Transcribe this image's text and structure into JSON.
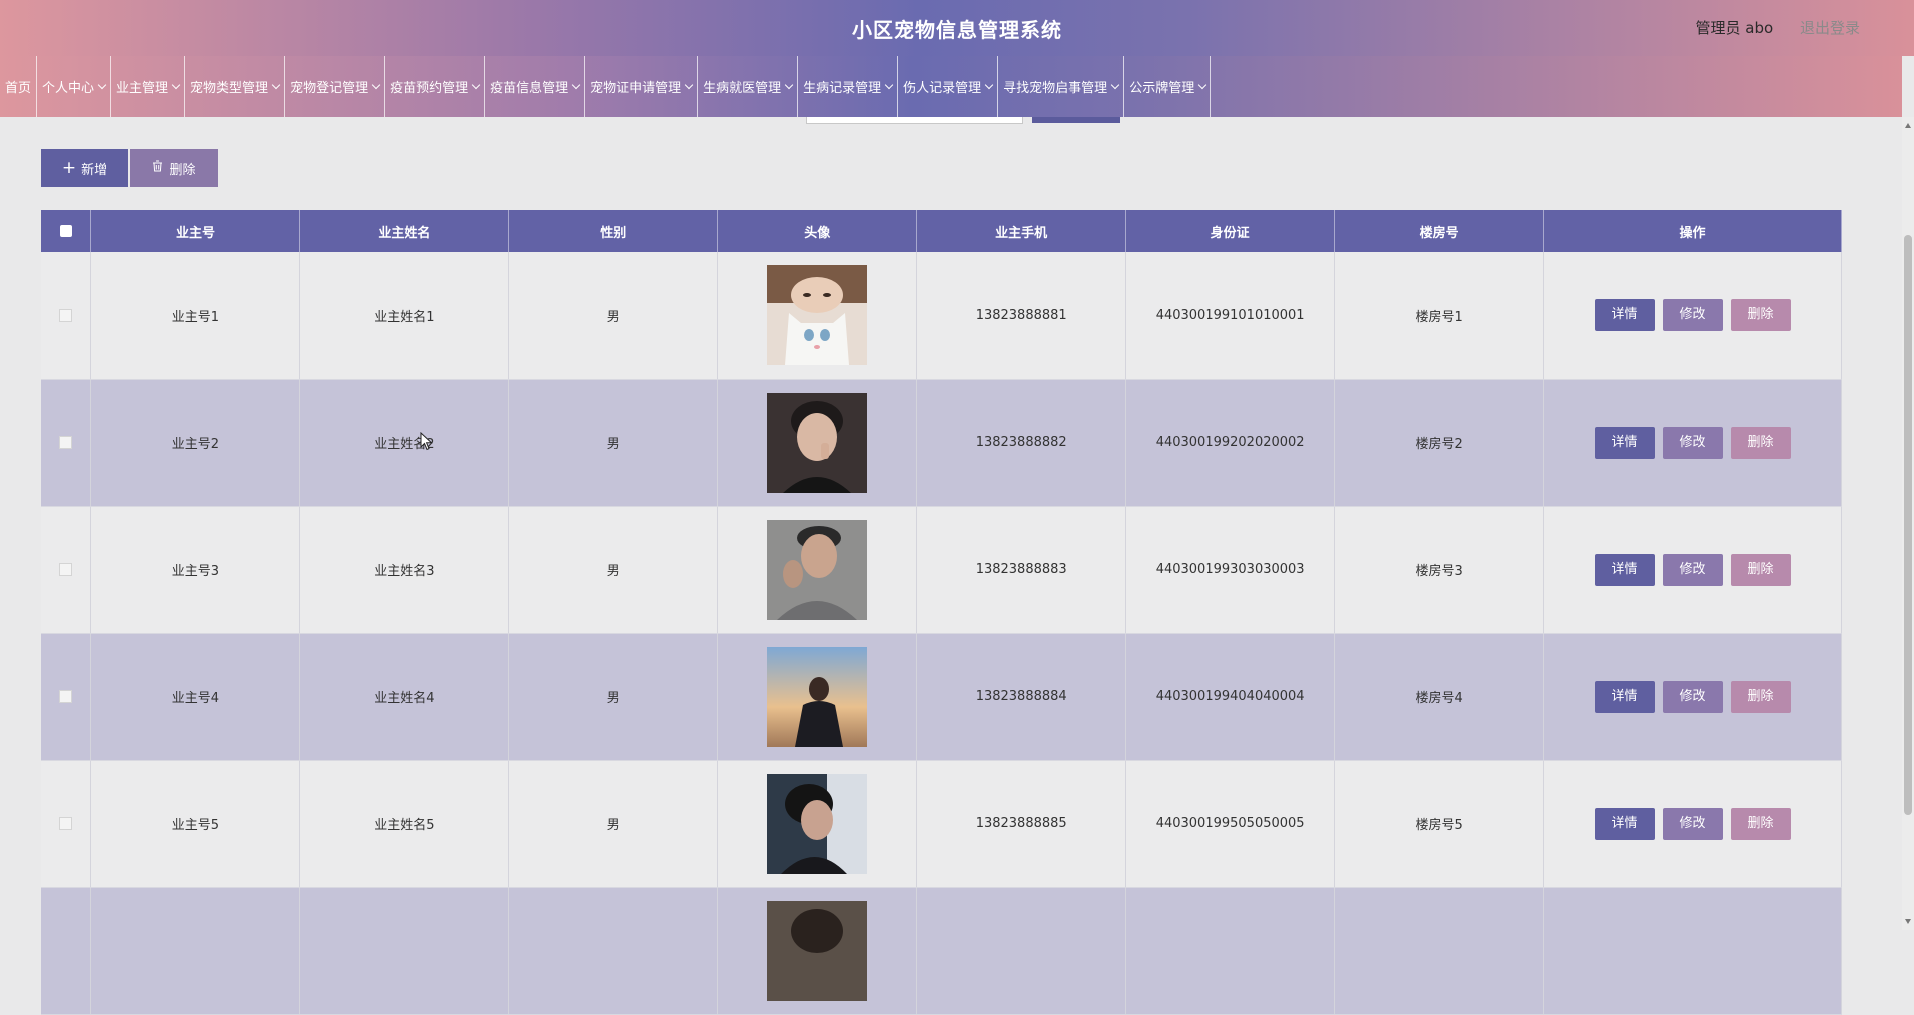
{
  "header": {
    "title": "小区宠物信息管理系统",
    "user_label": "管理员 abo",
    "logout_label": "退出登录"
  },
  "nav": [
    {
      "label": "首页",
      "dropdown": false
    },
    {
      "label": "个人中心",
      "dropdown": true
    },
    {
      "label": "业主管理",
      "dropdown": true
    },
    {
      "label": "宠物类型管理",
      "dropdown": true
    },
    {
      "label": "宠物登记管理",
      "dropdown": true
    },
    {
      "label": "疫苗预约管理",
      "dropdown": true
    },
    {
      "label": "疫苗信息管理",
      "dropdown": true
    },
    {
      "label": "宠物证申请管理",
      "dropdown": true
    },
    {
      "label": "生病就医管理",
      "dropdown": true
    },
    {
      "label": "生病记录管理",
      "dropdown": true
    },
    {
      "label": "伤人记录管理",
      "dropdown": true
    },
    {
      "label": "寻找宠物启事管理",
      "dropdown": true
    },
    {
      "label": "公示牌管理",
      "dropdown": true
    }
  ],
  "toolbar": {
    "add_label": "新增",
    "delete_label": "删除"
  },
  "table": {
    "headers": [
      "业主号",
      "业主姓名",
      "性别",
      "头像",
      "业主手机",
      "身份证",
      "楼房号",
      "操作"
    ],
    "rows": [
      {
        "owner_no": "业主号1",
        "owner_name": "业主姓名1",
        "gender": "男",
        "phone": "13823888881",
        "id_card": "440300199101010001",
        "building": "楼房号1"
      },
      {
        "owner_no": "业主号2",
        "owner_name": "业主姓名2",
        "gender": "男",
        "phone": "13823888882",
        "id_card": "440300199202020002",
        "building": "楼房号2"
      },
      {
        "owner_no": "业主号3",
        "owner_name": "业主姓名3",
        "gender": "男",
        "phone": "13823888883",
        "id_card": "440300199303030003",
        "building": "楼房号3"
      },
      {
        "owner_no": "业主号4",
        "owner_name": "业主姓名4",
        "gender": "男",
        "phone": "13823888884",
        "id_card": "440300199404040004",
        "building": "楼房号4"
      },
      {
        "owner_no": "业主号5",
        "owner_name": "业主姓名5",
        "gender": "男",
        "phone": "13823888885",
        "id_card": "440300199505050005",
        "building": "楼房号5"
      }
    ],
    "actions": {
      "detail": "详情",
      "edit": "修改",
      "delete": "删除"
    }
  },
  "colors": {
    "primary": "#6262a6",
    "edit": "#8a78ac",
    "delete": "#b78aac",
    "row_alt": "#c5c3d8"
  }
}
